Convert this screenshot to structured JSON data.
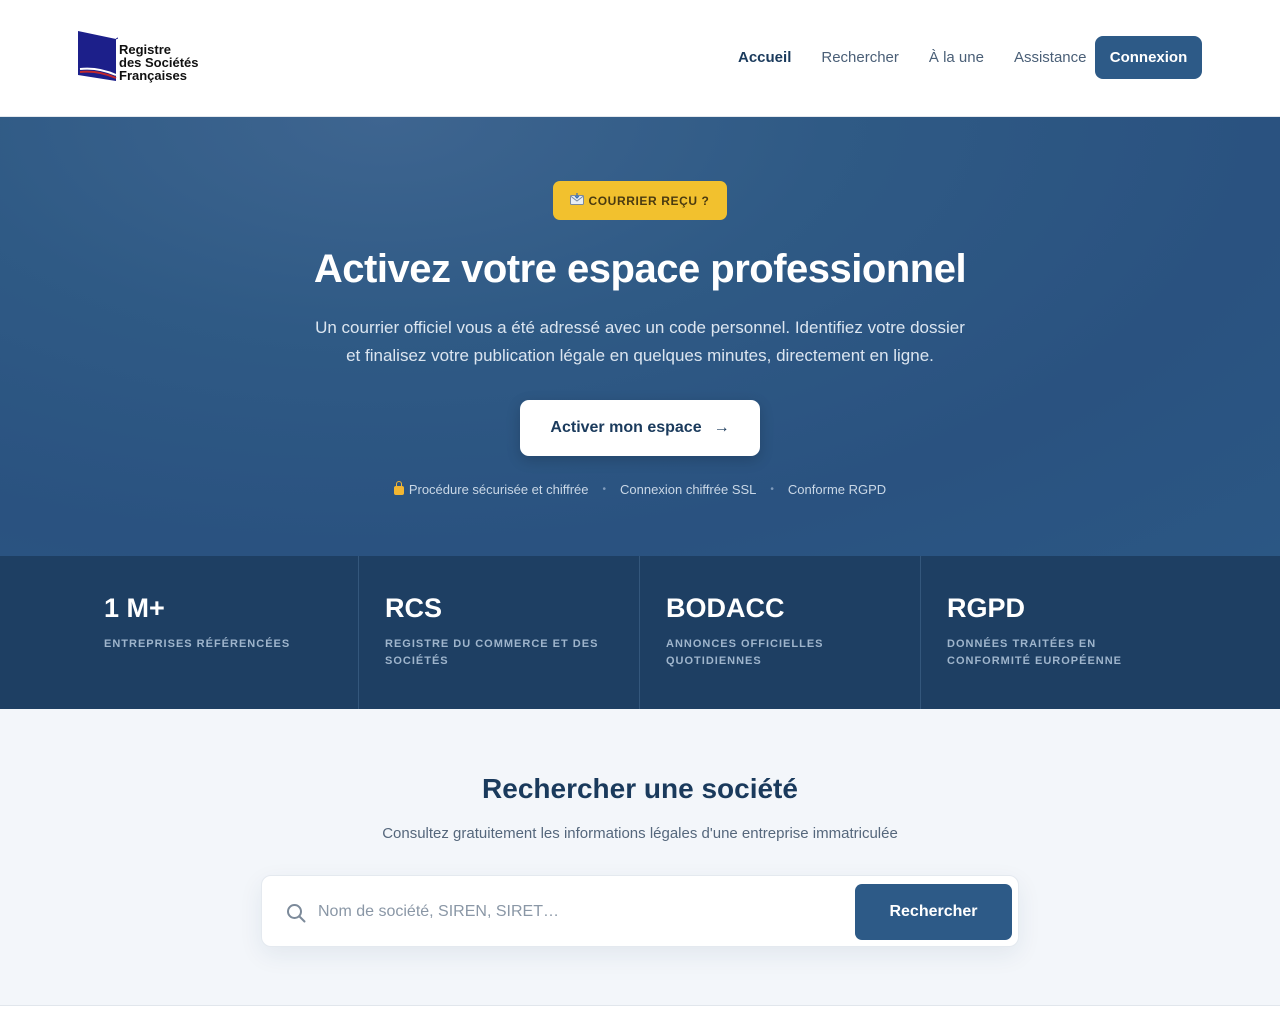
{
  "brand": {
    "logo_line1": "Registre",
    "logo_line2": "des Sociétés",
    "logo_line3": "Françaises",
    "logo_mark_color": "#1c1f8a",
    "logo_stripe_red": "#c0282d"
  },
  "nav": {
    "items": [
      {
        "label": "Accueil",
        "active": true
      },
      {
        "label": "Rechercher",
        "active": false
      },
      {
        "label": "À la une",
        "active": false
      },
      {
        "label": "Assistance",
        "active": false
      }
    ],
    "login_label": "Connexion"
  },
  "hero": {
    "badge_icon": "envelope-icon",
    "badge_label": "COURRIER REÇU ?",
    "title": "Activez votre espace professionnel",
    "subtitle_line1": "Un courrier officiel vous a été adressé avec un code personnel. Identifiez votre dossier",
    "subtitle_line2": "et finalisez votre publication légale en quelques minutes, directement en ligne.",
    "cta_label": "Activer mon espace",
    "cta_arrow": "→",
    "trust": [
      "Procédure sécurisée et chiffrée",
      "Connexion chiffrée SSL",
      "Conforme RGPD"
    ],
    "trust_separator": "•"
  },
  "stats": [
    {
      "value": "1 M+",
      "label": "Entreprises référencées"
    },
    {
      "value": "RCS",
      "label": "Registre du commerce et des sociétés"
    },
    {
      "value": "BODACC",
      "label": "Annonces officielles quotidiennes"
    },
    {
      "value": "RGPD",
      "label": "Données traitées en conformité européenne"
    }
  ],
  "search": {
    "title": "Rechercher une société",
    "subtitle": "Consultez gratuitement les informations légales d'une entreprise immatriculée",
    "placeholder": "Nom de société, SIREN, SIRET…",
    "value": "",
    "button_label": "Rechercher"
  },
  "colors": {
    "primary": "#2d5a87",
    "hero_bg": "#2c5583",
    "stats_bg": "#1e3f63",
    "badge": "#f2c12e",
    "section_bg": "#f3f6fa"
  }
}
